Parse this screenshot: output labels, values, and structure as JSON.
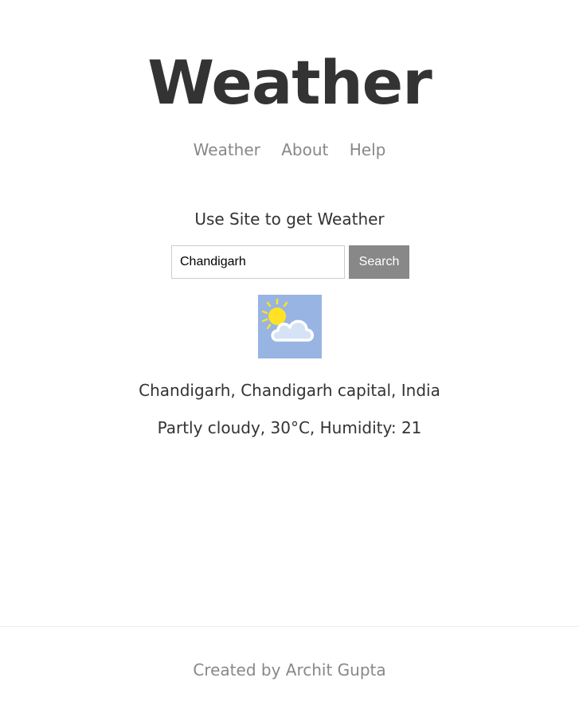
{
  "header": {
    "title": "Weather"
  },
  "nav": {
    "items": [
      {
        "label": "Weather"
      },
      {
        "label": "About"
      },
      {
        "label": "Help"
      }
    ]
  },
  "main": {
    "subtitle": "Use Site to get Weather",
    "search": {
      "value": "Chandigarh",
      "placeholder": "",
      "button_label": "Search"
    },
    "weather_icon": "partly-cloudy-icon",
    "location": "Chandigarh, Chandigarh capital, India",
    "forecast": "Partly cloudy, 30°C, Humidity: 21"
  },
  "footer": {
    "text": "Created by Archit Gupta"
  },
  "colors": {
    "title": "#333333",
    "nav_link": "#888888",
    "button_bg": "#888888",
    "icon_bg": "#97B4E3",
    "sun": "#FFE225",
    "cloud": "#D6E2F5"
  }
}
